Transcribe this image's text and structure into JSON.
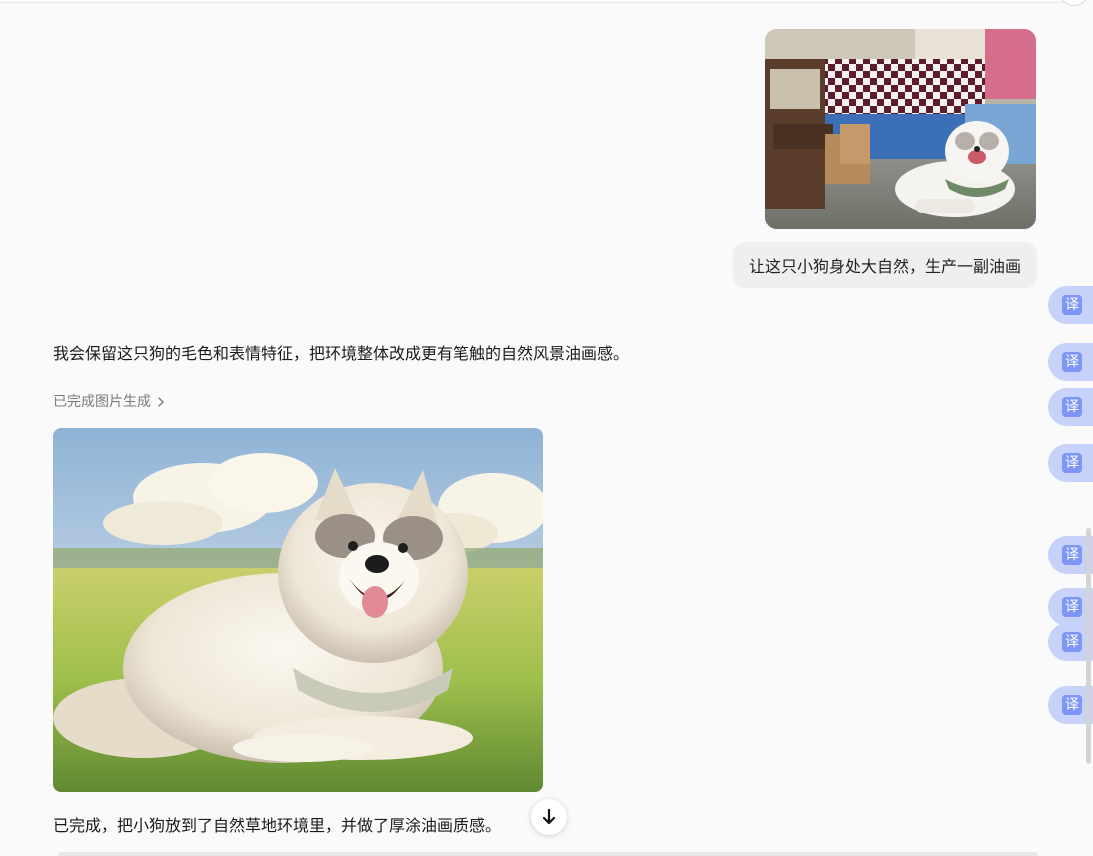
{
  "conversation": {
    "user_message": "让这只小狗身处大自然，生产一副油画",
    "assistant_intro": "我会保留这只狗的毛色和表情特征，把环境整体改成更有笔触的自然风景油画感。",
    "generation_status": "已完成图片生成",
    "assistant_final": "已完成，把小狗放到了自然草地环境里，并做了厚涂油画质感。"
  },
  "translate_buttons": [
    {
      "label": "译"
    },
    {
      "label": "译"
    },
    {
      "label": "译"
    },
    {
      "label": "译"
    },
    {
      "label": "译"
    },
    {
      "label": "译"
    },
    {
      "label": "译"
    },
    {
      "label": "译"
    }
  ],
  "icons": {
    "status_chevron": "chevron-right-icon",
    "scroll": "arrow-down-icon"
  },
  "colors": {
    "translate_pill": "#c7d2fb",
    "translate_badge": "#7d96f7",
    "user_bubble": "#efefef"
  }
}
